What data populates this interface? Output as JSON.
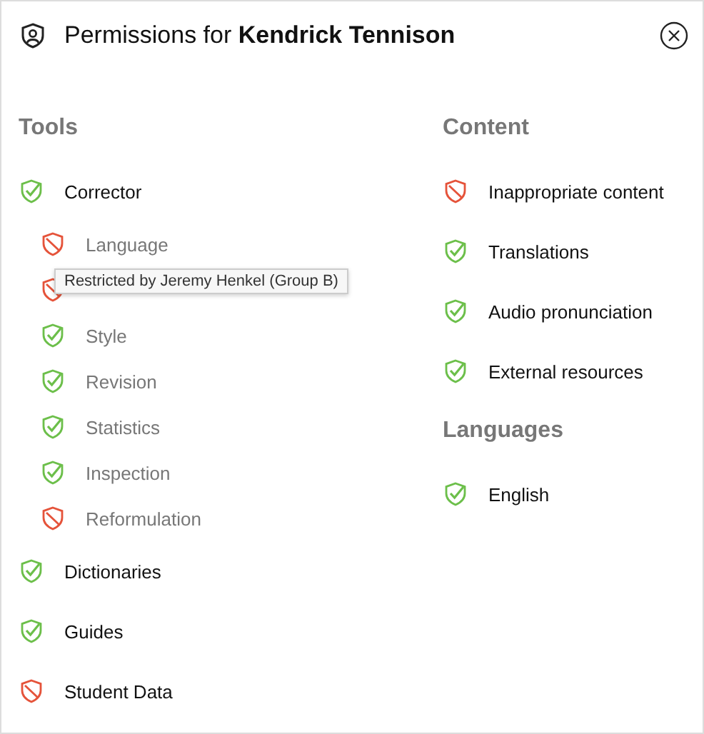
{
  "dialog": {
    "title": "Permissions for **Kendrick Tennison**"
  },
  "columns": [
    {
      "sections": [
        {
          "heading": "Tools",
          "items": [
            {
              "label": "Corrector",
              "allowed": true,
              "children": [
                {
                  "label": "Language",
                  "allowed": false
                },
                {
                  "allowed": false
                },
                {
                  "label": "Style",
                  "allowed": true
                },
                {
                  "label": "Revision",
                  "allowed": true
                },
                {
                  "label": "Statistics",
                  "allowed": true
                },
                {
                  "label": "Inspection",
                  "allowed": true
                },
                {
                  "label": "Reformulation",
                  "allowed": false
                }
              ]
            },
            {
              "label": "Dictionaries",
              "allowed": true
            },
            {
              "label": "Guides",
              "allowed": true
            },
            {
              "label": "Student Data",
              "allowed": false
            }
          ]
        }
      ]
    },
    {
      "sections": [
        {
          "heading": "Content",
          "items": [
            {
              "label": "Inappropriate content",
              "allowed": false
            },
            {
              "label": "Translations",
              "allowed": true
            },
            {
              "label": "Audio pronunciation",
              "allowed": true
            },
            {
              "label": "External resources",
              "allowed": true
            }
          ]
        },
        {
          "heading": "Languages",
          "items": [
            {
              "label": "English",
              "allowed": true
            }
          ]
        }
      ]
    }
  ],
  "tooltip": {
    "text": "Restricted by Jeremy Henkel (Group B)"
  }
}
